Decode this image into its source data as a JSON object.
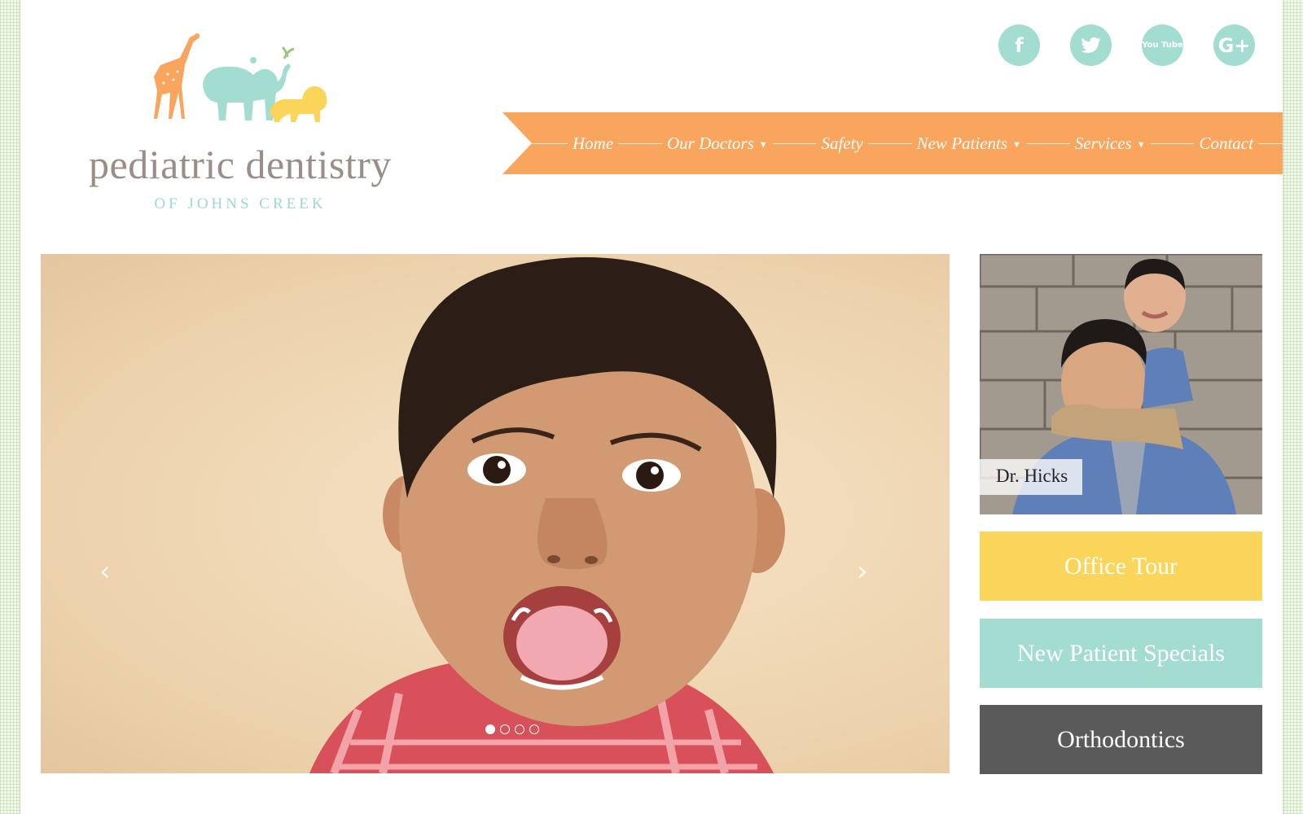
{
  "logo": {
    "main": "pediatric dentistry",
    "sub": "OF JOHNS CREEK"
  },
  "social": [
    {
      "name": "facebook-icon",
      "glyph": "f"
    },
    {
      "name": "twitter-icon",
      "glyph": "🐦"
    },
    {
      "name": "youtube-icon",
      "glyph": "You Tube"
    },
    {
      "name": "google-plus-icon",
      "glyph": "G+"
    }
  ],
  "nav": {
    "items": [
      {
        "label": "Home",
        "has_menu": false
      },
      {
        "label": "Our Doctors",
        "has_menu": true
      },
      {
        "label": "Safety",
        "has_menu": false
      },
      {
        "label": "New Patients",
        "has_menu": true
      },
      {
        "label": "Services",
        "has_menu": true
      },
      {
        "label": "Contact",
        "has_menu": false
      }
    ]
  },
  "hero": {
    "prev_glyph": "‹",
    "next_glyph": "›",
    "slide_count": 4,
    "active_slide": 1
  },
  "sidebar": {
    "doctor_label": "Dr. Hicks",
    "buttons": [
      {
        "label": "Office Tour",
        "color": "#fbd45a"
      },
      {
        "label": "New Patient Specials",
        "color": "#a3ddd2"
      },
      {
        "label": "Orthodontics",
        "color": "#5a5a5a"
      }
    ]
  },
  "colors": {
    "accent_orange": "#f9a55e",
    "accent_mint": "#a3ddd2",
    "accent_yellow": "#fbd45a",
    "dark_gray": "#5a5a5a"
  }
}
